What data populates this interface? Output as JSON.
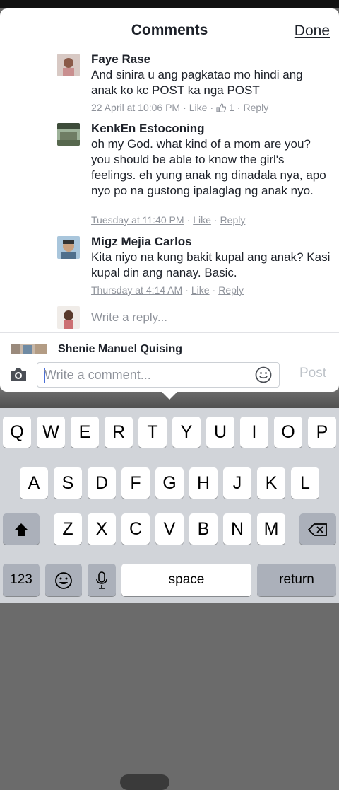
{
  "header": {
    "title": "Comments",
    "done_label": "Done"
  },
  "comments": [
    {
      "name": "Faye Rase",
      "text": "And sinira u ang pagkatao mo hindi ang anak ko kc POST ka nga POST",
      "time": "22 April at 10:06 PM",
      "like_label": "Like",
      "likes_count": "1",
      "reply_label": "Reply"
    },
    {
      "name": "KenkEn Estoconing",
      "text": "oh my God. what kind of a mom are you? you should be able to know the girl's feelings. eh yung anak ng dinadala nya, apo nyo po na gustong ipalaglag ng anak nyo.",
      "time": "Tuesday at 11:40 PM",
      "like_label": "Like",
      "reply_label": "Reply"
    },
    {
      "name": "Migz Mejia Carlos",
      "text": "Kita niyo na kung bakit kupal ang anak? Kasi kupal din ang nanay. Basic.",
      "time": "Thursday at 4:14 AM",
      "like_label": "Like",
      "reply_label": "Reply"
    }
  ],
  "reply_placeholder": "Write a reply...",
  "next_comment": {
    "name": "Shenie Manuel Quising"
  },
  "composer": {
    "placeholder": "Write a comment...",
    "post_label": "Post"
  },
  "keyboard": {
    "row1": [
      "Q",
      "W",
      "E",
      "R",
      "T",
      "Y",
      "U",
      "I",
      "O",
      "P"
    ],
    "row2": [
      "A",
      "S",
      "D",
      "F",
      "G",
      "H",
      "J",
      "K",
      "L"
    ],
    "row3": [
      "Z",
      "X",
      "C",
      "V",
      "B",
      "N",
      "M"
    ],
    "numbers_label": "123",
    "space_label": "space",
    "return_label": "return"
  },
  "icons": [
    "camera-icon",
    "smiley-icon",
    "thumbs-up-icon",
    "shift-icon",
    "backspace-icon",
    "emoji-icon",
    "microphone-icon"
  ],
  "colors": {
    "text": "#1d2129",
    "meta": "#90949c",
    "keyboard_bg": "#d1d4d9",
    "accent": "#4a6fd8"
  }
}
